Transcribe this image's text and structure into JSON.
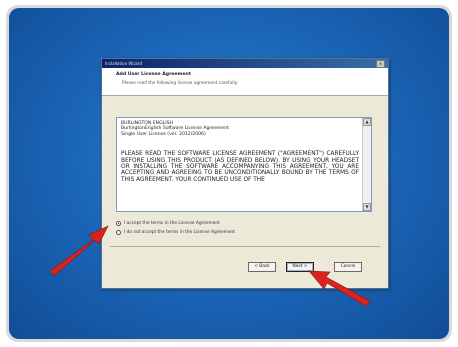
{
  "window": {
    "title": "Installation Wizard",
    "close_glyph": "×"
  },
  "header": {
    "title": "Add User License Agreement",
    "subtitle": "Please read the following license agreement carefully."
  },
  "license": {
    "line1": "BURLINGTON ENGLISH",
    "line2": "BurlingtonEnglish Software License Agreement",
    "line3": "Single User License (ver. 2012/2006)",
    "body": "PLEASE READ THE SOFTWARE LICENSE AGREEMENT (\"AGREEMENT\") CAREFULLY BEFORE USING THIS PRODUCT (AS DEFINED BELOW). BY USING YOUR HEADSET OR INSTALLING THE SOFTWARE ACCOMPANYING THIS AGREEMENT, YOU ARE ACCEPTING AND AGREEING TO BE UNCONDITIONALLY BOUND BY THE TERMS OF THIS AGREEMENT. YOUR CONTINUED USE OF THE"
  },
  "options": {
    "accept": "I accept the terms in the License Agreement",
    "decline": "I do not accept the terms in the License Agreement",
    "selected": "accept"
  },
  "buttons": {
    "back": "< Back",
    "next": "Next >",
    "cancel": "Cancel"
  },
  "colors": {
    "arrow": "#d8231f",
    "desktop": "#1a63b4"
  }
}
